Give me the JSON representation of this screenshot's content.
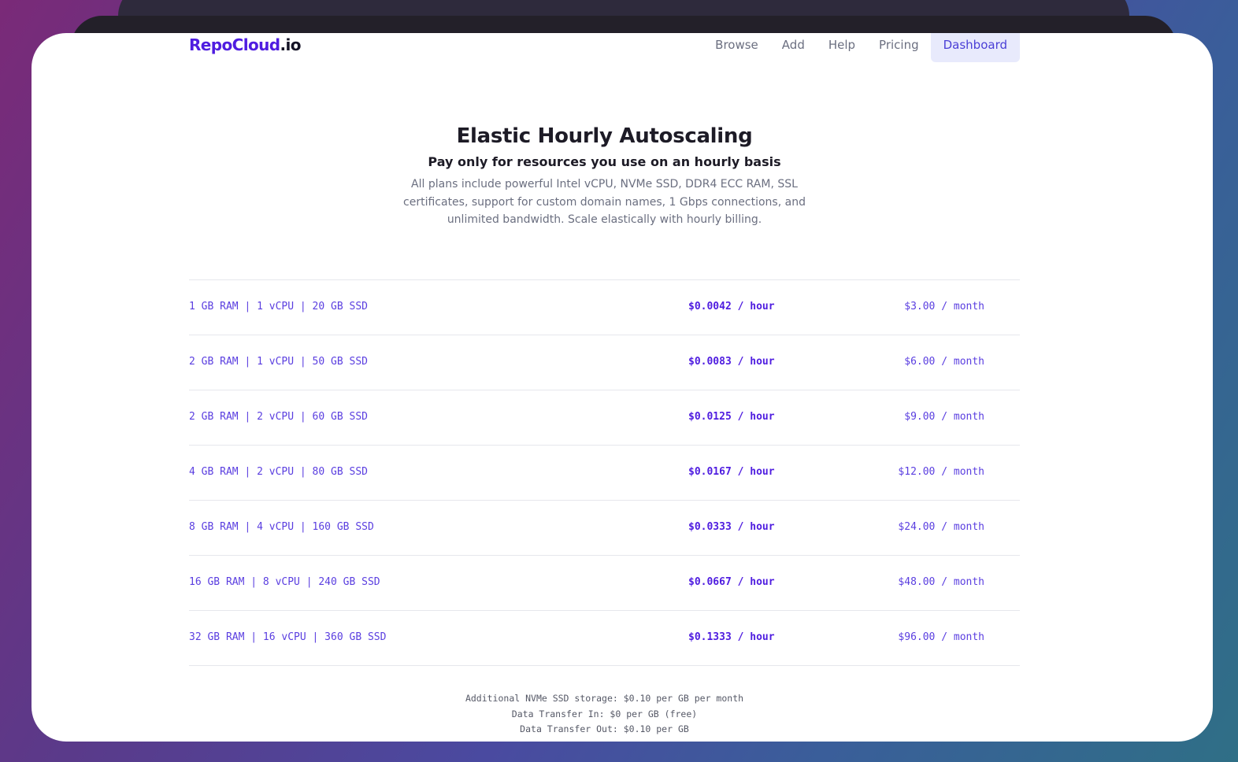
{
  "brand": {
    "name": "RepoCloud",
    "tld": ".io"
  },
  "nav": {
    "items": [
      {
        "label": "Browse"
      },
      {
        "label": "Add"
      },
      {
        "label": "Help"
      },
      {
        "label": "Pricing"
      },
      {
        "label": "Dashboard",
        "active": true
      }
    ]
  },
  "hero": {
    "title": "Elastic Hourly Autoscaling",
    "subtitle": "Pay only for resources you use on an hourly basis",
    "description": "All plans include powerful Intel vCPU, NVMe SSD, DDR4 ECC RAM, SSL certificates, support for custom domain names, 1 Gbps connections, and unlimited bandwidth. Scale elastically with hourly billing."
  },
  "plans": [
    {
      "spec": "1 GB RAM | 1 vCPU | 20 GB SSD",
      "hourly": "$0.0042 / hour",
      "monthly": "$3.00 / month"
    },
    {
      "spec": "2 GB RAM | 1 vCPU | 50 GB SSD",
      "hourly": "$0.0083 / hour",
      "monthly": "$6.00 / month"
    },
    {
      "spec": "2 GB RAM | 2 vCPU | 60 GB SSD",
      "hourly": "$0.0125 / hour",
      "monthly": "$9.00 / month"
    },
    {
      "spec": "4 GB RAM | 2 vCPU | 80 GB SSD",
      "hourly": "$0.0167 / hour",
      "monthly": "$12.00 / month"
    },
    {
      "spec": "8 GB RAM | 4 vCPU | 160 GB SSD",
      "hourly": "$0.0333 / hour",
      "monthly": "$24.00 / month"
    },
    {
      "spec": "16 GB RAM | 8 vCPU | 240 GB SSD",
      "hourly": "$0.0667 / hour",
      "monthly": "$48.00 / month"
    },
    {
      "spec": "32 GB RAM | 16 vCPU | 360 GB SSD",
      "hourly": "$0.1333 / hour",
      "monthly": "$96.00 / month"
    }
  ],
  "notes": [
    "Additional NVMe SSD storage: $0.10 per GB per month",
    "Data Transfer In: $0 per GB (free)",
    "Data Transfer Out: $0.10 per GB"
  ],
  "colors": {
    "brand": "#4f1de0",
    "accent": "#5a3ee0",
    "active_nav_bg": "#e8eafc",
    "heading": "#1d1b26",
    "muted": "#6b6f80"
  }
}
